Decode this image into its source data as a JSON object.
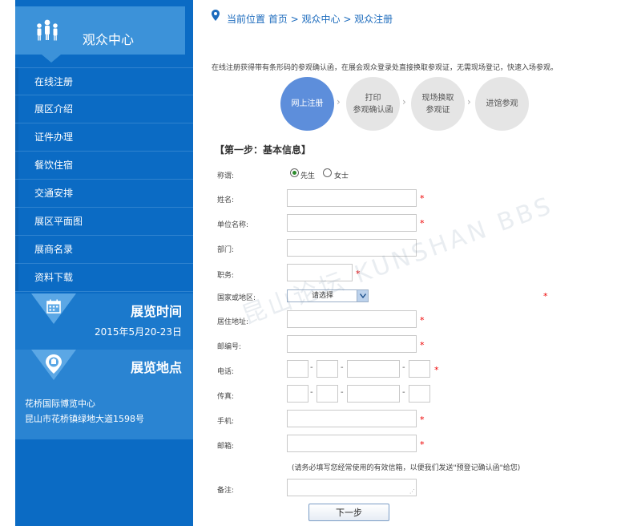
{
  "sidebar": {
    "title": "观众中心",
    "items": [
      {
        "label": "在线注册"
      },
      {
        "label": "展区介绍"
      },
      {
        "label": "证件办理"
      },
      {
        "label": "餐饮住宿"
      },
      {
        "label": "交通安排"
      },
      {
        "label": "展区平面图"
      },
      {
        "label": "展商名录"
      },
      {
        "label": "资料下载"
      }
    ],
    "time": {
      "title": "展览时间",
      "date": "2015年5月20-23日"
    },
    "place": {
      "title": "展览地点",
      "line1": "花桥国际博览中心",
      "line2": "昆山市花桥镇绿地大道1598号"
    }
  },
  "breadcrumb": "当前位置 首页 > 观众中心 > 观众注册",
  "intro": "在线注册获得带有条形码的参观确认函，在展会观众登录处直接换取参观证，无需现场登记，快速入场参观。",
  "steps": [
    {
      "label": "网上注册"
    },
    {
      "label": "打印\n参观确认函"
    },
    {
      "label": "现场换取\n参观证"
    },
    {
      "label": "进馆参观"
    }
  ],
  "form": {
    "section_title": "【第一步：基本信息】",
    "title_label": "称谓:",
    "radio_mr": "先生",
    "radio_ms": "女士",
    "name_label": "姓名:",
    "company_label": "单位名称:",
    "dept_label": "部门:",
    "position_label": "职务:",
    "country_label": "国家或地区:",
    "country_select": "请选择",
    "address_label": "居住地址:",
    "zip_label": "邮编号:",
    "phone_label": "电话:",
    "fax_label": "传真:",
    "mobile_label": "手机:",
    "email_label": "邮箱:",
    "email_note": "(请务必填写您经常使用的有效信箱，以便我们发送\"预登记确认函\"给您)",
    "remark_label": "备注:",
    "required_mark": "*",
    "dash": "-",
    "next_button": "下一步"
  },
  "watermark": "昆山论坛 KUNSHAN BBS",
  "colors": {
    "sidebar": "#0b6bc4",
    "step_active": "#5d8edb",
    "link": "#1c6bbd",
    "required": "#e00000"
  }
}
